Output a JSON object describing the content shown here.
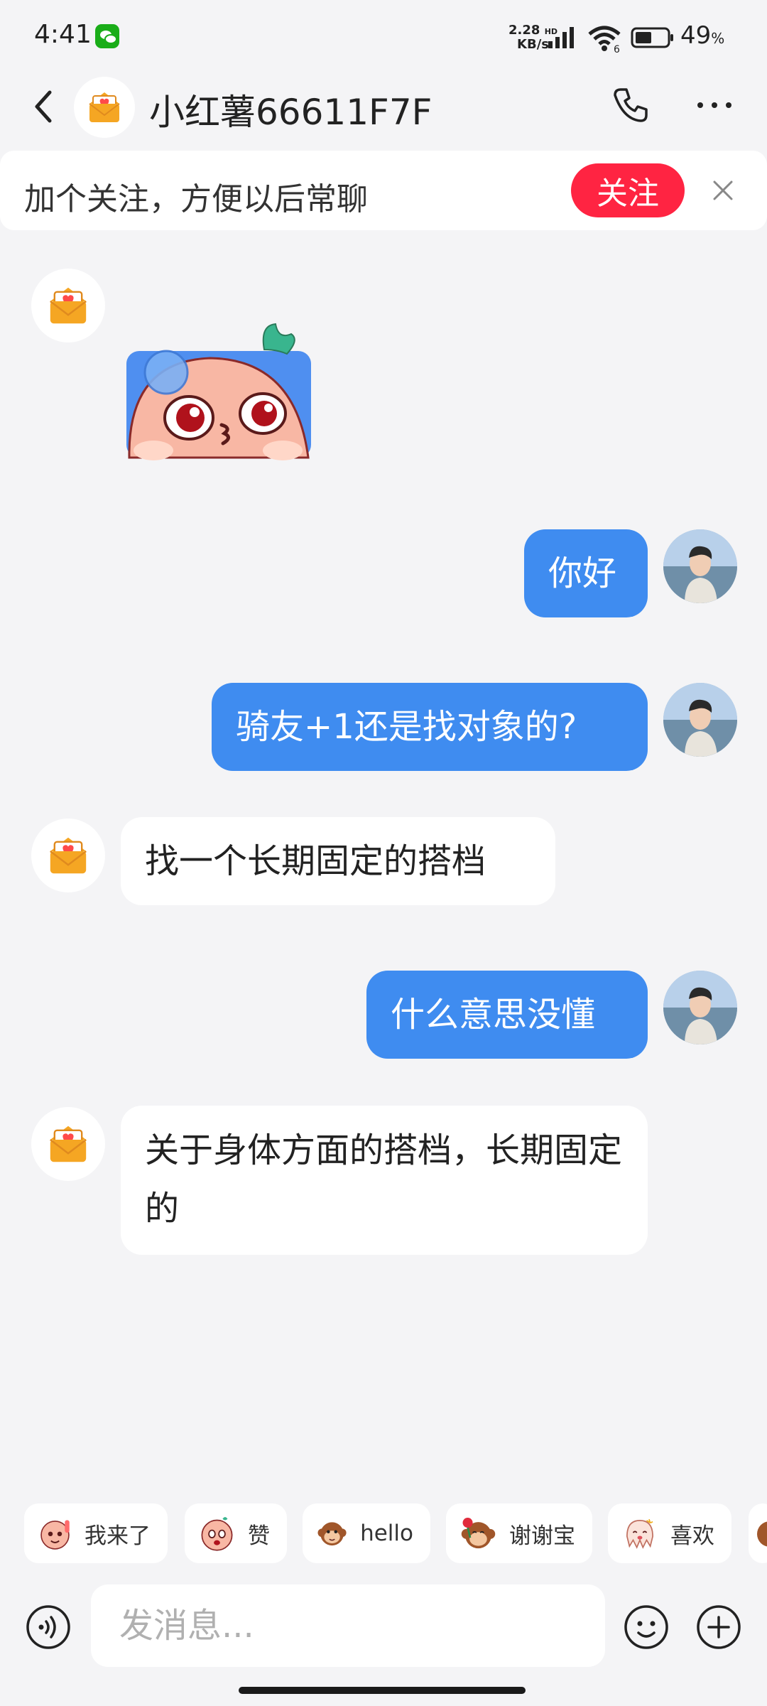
{
  "status_bar": {
    "time": "4:41",
    "net_speed_value": "2.28",
    "net_speed_unit": "KB/s",
    "net_hd": "HD",
    "battery_percent": "49",
    "battery_unit": "%"
  },
  "header": {
    "title": "小红薯66611F7F"
  },
  "follow_banner": {
    "text": "加个关注，方便以后常聊",
    "button_label": "关注"
  },
  "messages": [
    {
      "from": "contact",
      "type": "sticker"
    },
    {
      "from": "me",
      "text": "你好"
    },
    {
      "from": "me",
      "text": "骑友+1还是找对象的?"
    },
    {
      "from": "contact",
      "text": "找一个长期固定的搭档"
    },
    {
      "from": "me",
      "text": "什么意思没懂"
    },
    {
      "from": "contact",
      "text": "关于身体方面的搭档，长期固定的"
    }
  ],
  "sticker_bar": [
    {
      "label": "我来了",
      "icon": "peach-wave-icon"
    },
    {
      "label": "赞",
      "icon": "peach-thumbs-icon"
    },
    {
      "label": "hello",
      "icon": "monkey-hello-icon"
    },
    {
      "label": "谢谢宝",
      "icon": "monkey-rose-icon"
    },
    {
      "label": "喜欢",
      "icon": "octopus-love-icon"
    }
  ],
  "composer": {
    "placeholder": "发消息..."
  },
  "colors": {
    "accent_red": "#ff2442",
    "outgoing_bubble": "#3f8cf0",
    "background": "#f4f4f6"
  }
}
